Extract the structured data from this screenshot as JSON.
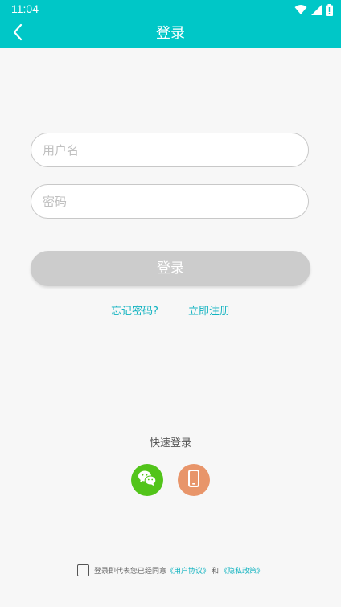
{
  "status_bar": {
    "time": "11:04",
    "icons": [
      "wifi-icon",
      "cellular-icon",
      "battery-icon"
    ]
  },
  "header": {
    "back_icon": "chevron-left-icon",
    "title": "登录"
  },
  "form": {
    "username_placeholder": "用户名",
    "password_placeholder": "密码",
    "login_label": "登录"
  },
  "links": {
    "forgot_password": "忘记密码?",
    "register": "立即注册"
  },
  "quick_login": {
    "label": "快速登录",
    "options": [
      "wechat-icon",
      "phone-icon"
    ]
  },
  "agreement": {
    "prefix": "登录即代表您已经同意",
    "user_agreement": "《用户协议》",
    "and": "和",
    "privacy_policy": "《隐私政策》",
    "checked": false
  },
  "colors": {
    "brand": "#00c7c7",
    "link": "#11b3c0",
    "button_disabled": "#cccccc",
    "wechat": "#52c41a",
    "phone": "#e8956a"
  }
}
